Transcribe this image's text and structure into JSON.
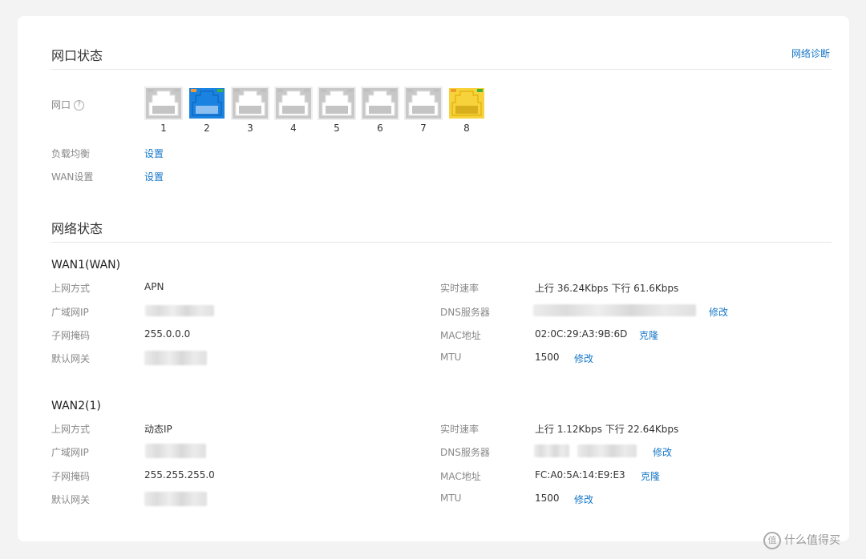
{
  "port_status": {
    "title": "网口状态",
    "diagnose_link": "网络诊断",
    "ports_label": "网口",
    "help_glyph": "?",
    "ports": [
      {
        "num": "1",
        "state": "inactive",
        "color": "#c8c8c8"
      },
      {
        "num": "2",
        "state": "active",
        "color": "#1a82e0"
      },
      {
        "num": "3",
        "state": "inactive",
        "color": "#c8c8c8"
      },
      {
        "num": "4",
        "state": "inactive",
        "color": "#c8c8c8"
      },
      {
        "num": "5",
        "state": "inactive",
        "color": "#c8c8c8"
      },
      {
        "num": "6",
        "state": "inactive",
        "color": "#c8c8c8"
      },
      {
        "num": "7",
        "state": "inactive",
        "color": "#c8c8c8"
      },
      {
        "num": "8",
        "state": "wan",
        "color": "#f7d23a"
      }
    ],
    "load_balance_label": "负载均衡",
    "load_balance_link": "设置",
    "wan_settings_label": "WAN设置",
    "wan_settings_link": "设置"
  },
  "network_status": {
    "title": "网络状态",
    "wan1": {
      "name": "WAN1(WAN)",
      "access_label": "上网方式",
      "access_value": "APN",
      "wan_ip_label": "广域网IP",
      "subnet_label": "子网掩码",
      "subnet_value": "255.0.0.0",
      "gateway_label": "默认网关",
      "speed_label": "实时速率",
      "speed_value": "上行 36.24Kbps  下行 61.6Kbps",
      "dns_label": "DNS服务器",
      "dns_link": "修改",
      "mac_label": "MAC地址",
      "mac_value": "02:0C:29:A3:9B:6D",
      "mac_link": "克隆",
      "mtu_label": "MTU",
      "mtu_value": "1500",
      "mtu_link": "修改"
    },
    "wan2": {
      "name": "WAN2(1)",
      "access_label": "上网方式",
      "access_value": "动态IP",
      "wan_ip_label": "广域网IP",
      "subnet_label": "子网掩码",
      "subnet_value": "255.255.255.0",
      "gateway_label": "默认网关",
      "speed_label": "实时速率",
      "speed_value": "上行 1.12Kbps  下行 22.64Kbps",
      "dns_label": "DNS服务器",
      "dns_link": "修改",
      "mac_label": "MAC地址",
      "mac_value": "FC:A0:5A:14:E9:E3",
      "mac_link": "克隆",
      "mtu_label": "MTU",
      "mtu_value": "1500",
      "mtu_link": "修改"
    }
  },
  "watermark": {
    "icon_glyph": "值",
    "text": "什么值得买"
  }
}
